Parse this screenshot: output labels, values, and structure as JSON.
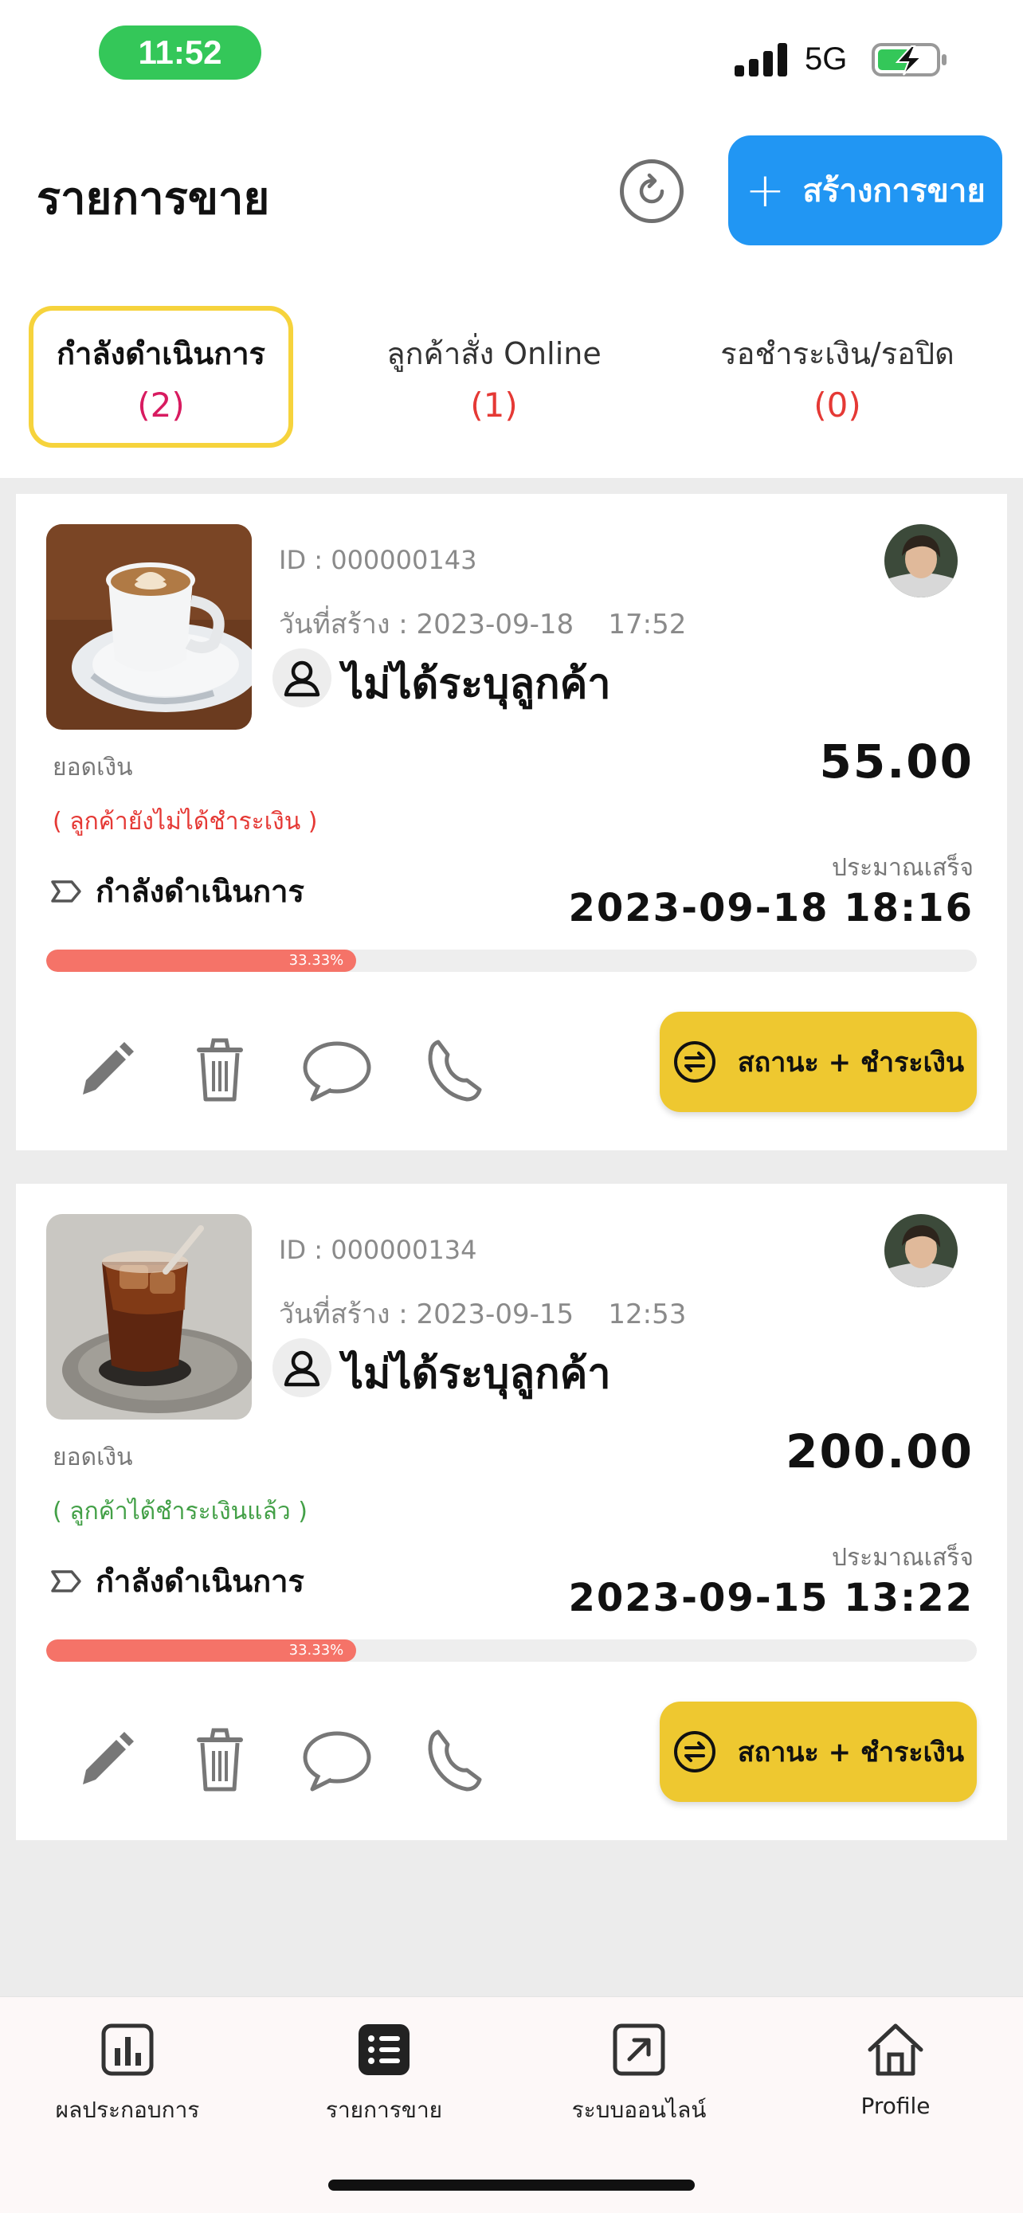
{
  "status_bar": {
    "time": "11:52",
    "network": "5G"
  },
  "header": {
    "title": "รายการขาย",
    "create_label": "สร้างการขาย"
  },
  "tabs": [
    {
      "label": "กำลังดำเนินการ",
      "count": "(2)",
      "active": true
    },
    {
      "label": "ลูกค้าสั่ง Online",
      "count": "(1)",
      "active": false
    },
    {
      "label": "รอชำระเงิน/รอปิด",
      "count": "(0)",
      "active": false
    }
  ],
  "orders": [
    {
      "id": "ID : 000000143",
      "created": "วันที่สร้าง : 2023-09-18    17:52",
      "customer": "ไม่ได้ระบุลูกค้า",
      "amount_label": "ยอดเงิน",
      "amount": "55.00",
      "payment_status": "( ลูกค้ายังไม่ได้ชำระเงิน )",
      "stage": "กำลังดำเนินการ",
      "eta_label": "ประมาณเสร็จ",
      "eta": "2023-09-18 18:16",
      "progress_label": "33.33%",
      "progress": 0.3333,
      "status_button": "สถานะ + ชำระเงิน"
    },
    {
      "id": "ID : 000000134",
      "created": "วันที่สร้าง : 2023-09-15    12:53",
      "customer": "ไม่ได้ระบุลูกค้า",
      "amount_label": "ยอดเงิน",
      "amount": "200.00",
      "payment_status": "( ลูกค้าได้ชำระเงินแล้ว )",
      "stage": "กำลังดำเนินการ",
      "eta_label": "ประมาณเสร็จ",
      "eta": "2023-09-15 13:22",
      "progress_label": "33.33%",
      "progress": 0.3333,
      "status_button": "สถานะ + ชำระเงิน"
    }
  ],
  "bottom_nav": [
    {
      "label": "ผลประกอบการ",
      "icon": "bar-chart-icon"
    },
    {
      "label": "รายการขาย",
      "icon": "list-icon"
    },
    {
      "label": "ระบบออนไลน์",
      "icon": "external-link-icon"
    },
    {
      "label": "Profile",
      "icon": "home-icon"
    }
  ],
  "colors": {
    "primary": "#2196f3",
    "active_tab_border": "#f6d33c",
    "status_button": "#eec830",
    "progress": "#f57368",
    "unpaid": "#e53935",
    "paid": "#43a047",
    "clock_pill": "#34c759"
  }
}
